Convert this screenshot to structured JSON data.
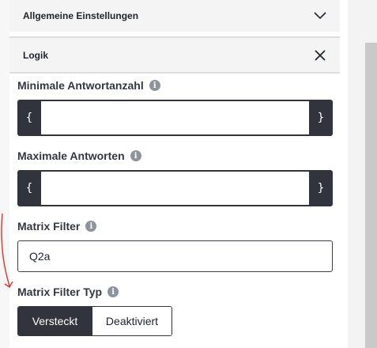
{
  "sections": {
    "general": {
      "title": "Allgemeine Einstellungen",
      "icon": "chevron-down-icon"
    },
    "logic": {
      "title": "Logik",
      "icon": "close-icon"
    }
  },
  "fields": {
    "min_answers": {
      "label": "Minimale Antwortanzahl",
      "value": "",
      "prefix": "{",
      "suffix": "}"
    },
    "max_answers": {
      "label": "Maximale Antworten",
      "value": "",
      "prefix": "{",
      "suffix": "}"
    },
    "matrix_filter": {
      "label": "Matrix Filter",
      "value": "Q2a"
    },
    "matrix_filter_type": {
      "label": "Matrix Filter Typ",
      "options": [
        "Versteckt",
        "Deaktiviert"
      ],
      "selected": "Versteckt"
    }
  },
  "info_icon_glyph": "i",
  "colors": {
    "dark": "#31343d",
    "header_bg": "#f4f4f4",
    "info_icon": "#8e939c",
    "annotation": "#e03030"
  }
}
